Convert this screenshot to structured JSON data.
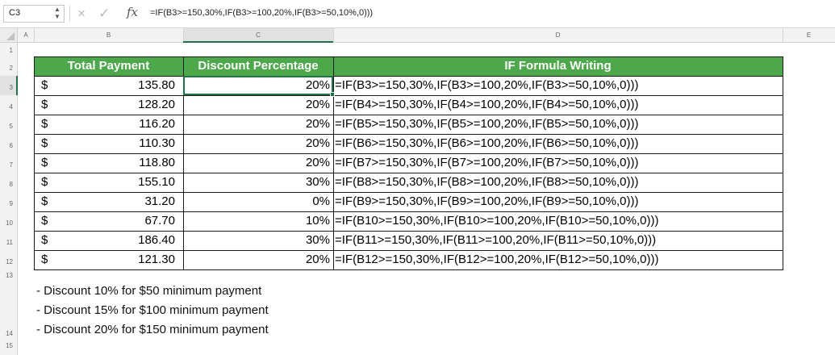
{
  "formula_bar": {
    "name_box": "C3",
    "cancel_icon": "×",
    "enter_icon": "✓",
    "fx_label": "fx",
    "formula": "=IF(B3>=150,30%,IF(B3>=100,20%,IF(B3>=50,10%,0)))"
  },
  "columns": [
    "A",
    "B",
    "C",
    "D",
    "E"
  ],
  "rows": [
    "1",
    "2",
    "3",
    "4",
    "5",
    "6",
    "7",
    "8",
    "9",
    "10",
    "11",
    "12",
    "13",
    "14",
    "15"
  ],
  "table": {
    "headers": [
      "Total Payment",
      "Discount Percentage",
      "IF Formula Writing"
    ],
    "currency": "$",
    "data": [
      {
        "amount": "135.80",
        "discount": "20%",
        "formula": "=IF(B3>=150,30%,IF(B3>=100,20%,IF(B3>=50,10%,0)))"
      },
      {
        "amount": "128.20",
        "discount": "20%",
        "formula": "=IF(B4>=150,30%,IF(B4>=100,20%,IF(B4>=50,10%,0)))"
      },
      {
        "amount": "116.20",
        "discount": "20%",
        "formula": "=IF(B5>=150,30%,IF(B5>=100,20%,IF(B5>=50,10%,0)))"
      },
      {
        "amount": "110.30",
        "discount": "20%",
        "formula": "=IF(B6>=150,30%,IF(B6>=100,20%,IF(B6>=50,10%,0)))"
      },
      {
        "amount": "118.80",
        "discount": "20%",
        "formula": "=IF(B7>=150,30%,IF(B7>=100,20%,IF(B7>=50,10%,0)))"
      },
      {
        "amount": "155.10",
        "discount": "30%",
        "formula": "=IF(B8>=150,30%,IF(B8>=100,20%,IF(B8>=50,10%,0)))"
      },
      {
        "amount": "31.20",
        "discount": "0%",
        "formula": "=IF(B9>=150,30%,IF(B9>=100,20%,IF(B9>=50,10%,0)))"
      },
      {
        "amount": "67.70",
        "discount": "10%",
        "formula": "=IF(B10>=150,30%,IF(B10>=100,20%,IF(B10>=50,10%,0)))"
      },
      {
        "amount": "186.40",
        "discount": "30%",
        "formula": "=IF(B11>=150,30%,IF(B11>=100,20%,IF(B11>=50,10%,0)))"
      },
      {
        "amount": "121.30",
        "discount": "20%",
        "formula": "=IF(B12>=150,30%,IF(B12>=100,20%,IF(B12>=50,10%,0)))"
      }
    ]
  },
  "notes": [
    "- Discount 10% for $50 minimum payment",
    "- Discount 15% for $100 minimum payment",
    "- Discount 20% for $150 minimum payment"
  ],
  "colors": {
    "header_fill": "#4ca84a",
    "selection": "#217346"
  }
}
